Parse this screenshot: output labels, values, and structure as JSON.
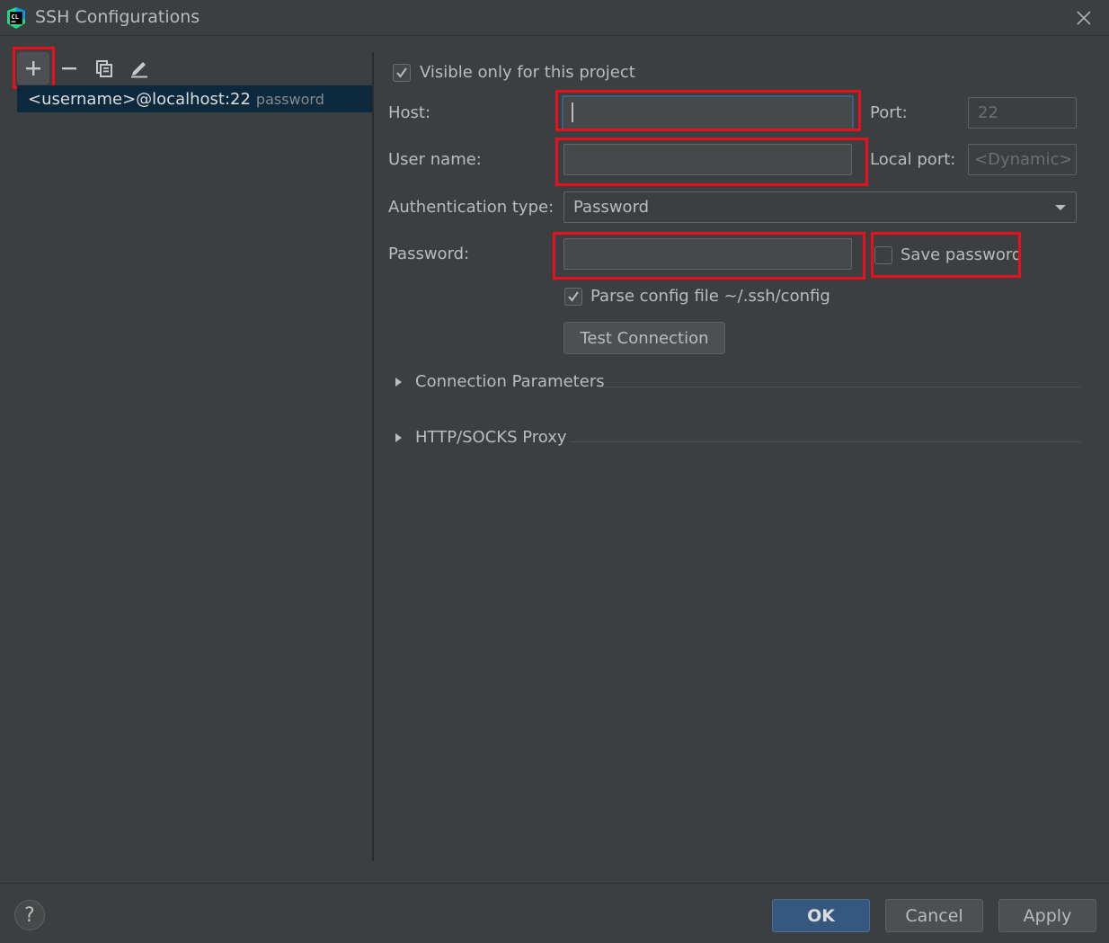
{
  "window": {
    "title": "SSH Configurations",
    "logo_text": "CL"
  },
  "list": {
    "items": [
      {
        "name": "<username>@localhost:22",
        "auth": "password"
      }
    ]
  },
  "form": {
    "visible_only_label": "Visible only for this project",
    "visible_only_checked": true,
    "host_label": "Host:",
    "host_value": "",
    "port_label": "Port:",
    "port_value": "22",
    "username_label": "User name:",
    "username_value": "",
    "local_port_label": "Local port:",
    "local_port_value": "<Dynamic>",
    "auth_type_label": "Authentication type:",
    "auth_type_value": "Password",
    "password_label": "Password:",
    "password_value": "",
    "save_password_label": "Save password",
    "save_password_checked": false,
    "parse_config_label": "Parse config file ~/.ssh/config",
    "parse_config_checked": true,
    "test_connection_label": "Test Connection"
  },
  "sections": {
    "connection_params": "Connection Parameters",
    "proxy": "HTTP/SOCKS Proxy"
  },
  "footer": {
    "help": "?",
    "ok": "OK",
    "cancel": "Cancel",
    "apply": "Apply"
  },
  "colors": {
    "background": "#3c3f41",
    "selection": "#0d293e",
    "primary_button": "#365880",
    "highlight": "#e8101a"
  }
}
